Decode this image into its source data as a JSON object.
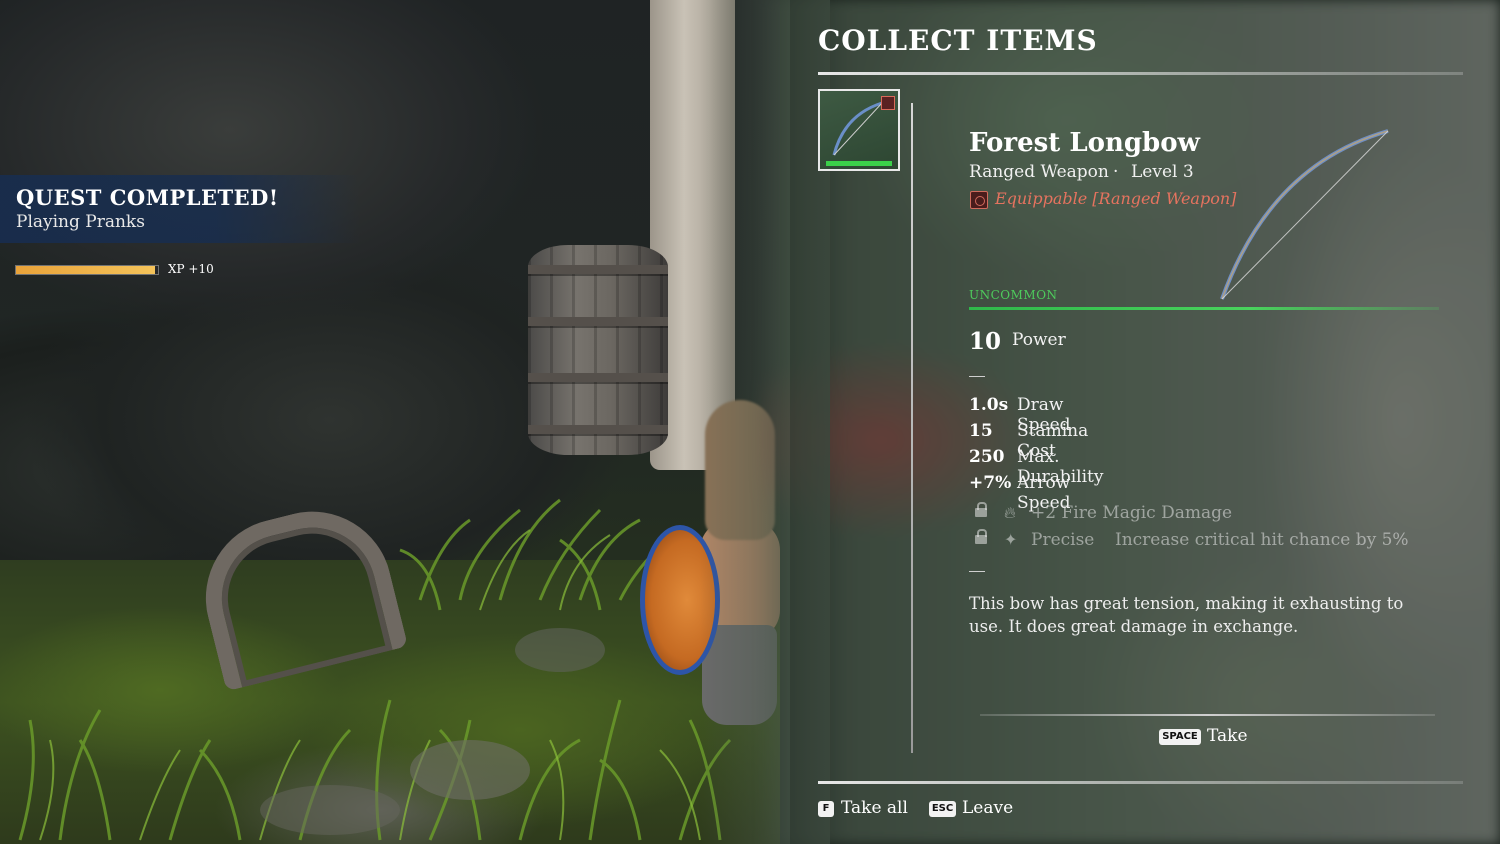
{
  "quest": {
    "title": "QUEST COMPLETED!",
    "name": "Playing Pranks",
    "xp_label": "XP +10",
    "xp_progress": 0.98
  },
  "panel": {
    "title": "COLLECT ITEMS",
    "item": {
      "name": "Forest Longbow",
      "type": "Ranged Weapon",
      "separator": "·",
      "level": "Level 3",
      "equip_text": "Equippable [Ranged Weapon]",
      "rarity": "UNCOMMON",
      "rarity_color": "#4ecb5c",
      "power_value": "10",
      "power_label": "Power",
      "stats": [
        {
          "value": "1.0s",
          "label": "Draw Speed"
        },
        {
          "value": "15",
          "label": "Stamina Cost"
        },
        {
          "value": "250",
          "label": "Max. Durability"
        },
        {
          "value": "+7%",
          "label": "Arrow Speed"
        }
      ],
      "locked_perks": [
        {
          "icon": "fire-icon",
          "name": "+2 Fire Magic Damage",
          "desc": ""
        },
        {
          "icon": "sparkle-icon",
          "name": "Precise",
          "desc": "Increase critical hit chance by 5%"
        }
      ],
      "description": "This bow has great tension, making it exhausting to use. It does great damage in exchange."
    },
    "take": {
      "key": "SPACE",
      "label": "Take"
    },
    "footer": {
      "take_all": {
        "key": "F",
        "label": "Take all"
      },
      "leave": {
        "key": "ESC",
        "label": "Leave"
      }
    }
  },
  "colors": {
    "equip_red": "#e5735f",
    "quest_blue": "#182d4e",
    "xp_orange": "#f4c35a"
  }
}
